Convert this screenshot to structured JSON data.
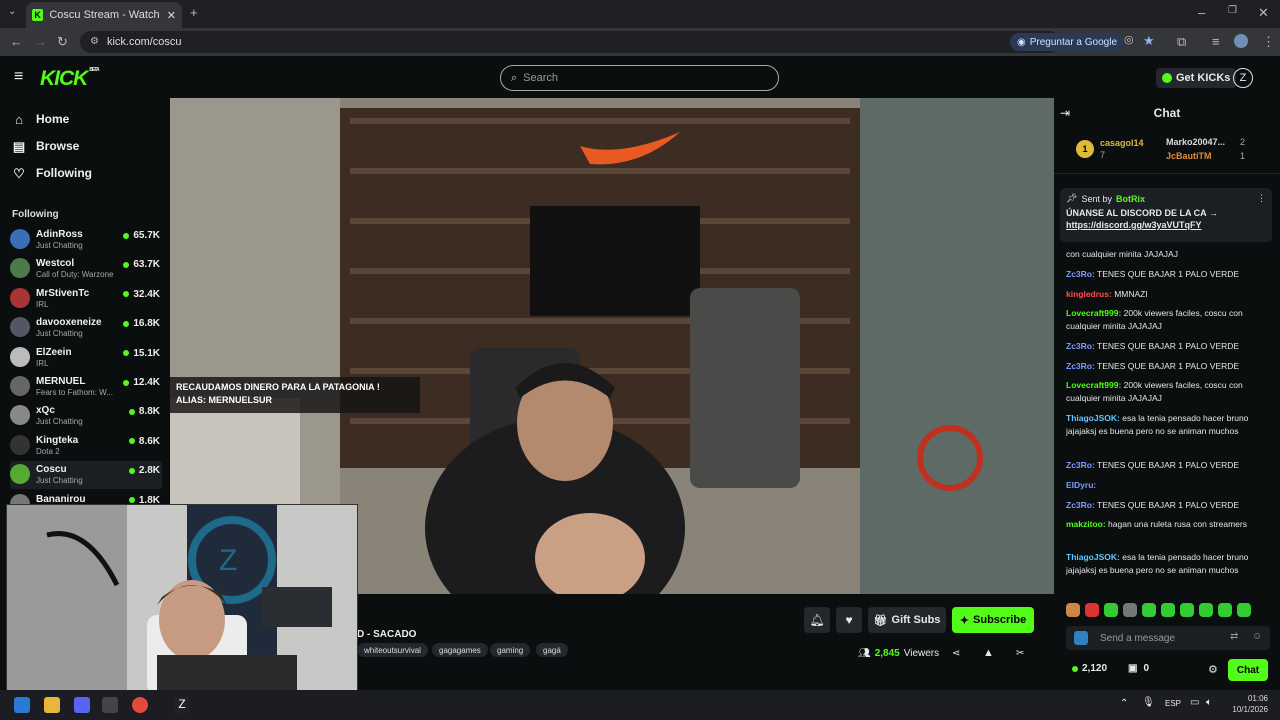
{
  "browser": {
    "tab_title": "Coscu Stream - Watch Live on K",
    "url": "kick.com/coscu",
    "ask_google": "Preguntar a Google"
  },
  "site": {
    "logo": "KICK",
    "logo_badge": "BETA",
    "search_placeholder": "Search",
    "get_kicks": "Get KICKs"
  },
  "sidebar": {
    "nav": [
      {
        "label": "Home",
        "icon": "home-icon"
      },
      {
        "label": "Browse",
        "icon": "browse-icon"
      },
      {
        "label": "Following",
        "icon": "heart-icon"
      }
    ],
    "following_header": "Following",
    "channels": [
      {
        "name": "AdinRoss",
        "category": "Just Chatting",
        "viewers": "65.7K"
      },
      {
        "name": "Westcol",
        "category": "Call of Duty: Warzone",
        "viewers": "63.7K"
      },
      {
        "name": "MrStivenTc",
        "category": "IRL",
        "viewers": "32.4K"
      },
      {
        "name": "davooxeneize",
        "category": "Just Chatting",
        "viewers": "16.8K"
      },
      {
        "name": "ElZeein",
        "category": "IRL",
        "viewers": "15.1K"
      },
      {
        "name": "MERNUEL",
        "category": "Fears to Fathom: W...",
        "viewers": "12.4K"
      },
      {
        "name": "xQc",
        "category": "Just Chatting",
        "viewers": "8.8K"
      },
      {
        "name": "Kingteka",
        "category": "Dota 2",
        "viewers": "8.6K"
      },
      {
        "name": "Coscu",
        "category": "Just Chatting",
        "viewers": "2.8K"
      },
      {
        "name": "Bananirou",
        "category": "",
        "viewers": "1.8K"
      }
    ]
  },
  "video": {
    "overlay_line1": "RECAUDAMOS DINERO PARA LA PATAGONIA !",
    "overlay_line2": "ALIAS: MERNUELSUR"
  },
  "stream": {
    "title": "D - SACADO",
    "tags": [
      "whiteoutsurvival",
      "gagagames",
      "gaming",
      "gagá"
    ],
    "gift_subs": "Gift Subs",
    "subscribe": "Subscribe",
    "viewers": "2,845",
    "viewers_label": "Viewers"
  },
  "chat": {
    "header": "Chat",
    "leader1_rank": "1",
    "leader1_name": "casagol14",
    "leader1_count": "7",
    "leader2_name": "Marko20047...",
    "leader2_count": "2",
    "leader3_name": "JcBautiTM",
    "leader3_count": "1",
    "pinned_sender_label": "Sent by",
    "pinned_sender": "BotRix",
    "pinned_text": "ÚNANSE AL DISCORD DE LA CA →",
    "pinned_link": "https://discord.gg/w3yaVUTqFY",
    "messages": [
      {
        "user": "",
        "text": "con cualquier minita JAJAJAJ",
        "color": "#e6e6e6"
      },
      {
        "user": "Zc3Ro:",
        "text": "TENES QUE BAJAR 1 PALO VERDE",
        "color": "#7d9bff"
      },
      {
        "user": "kingledrus:",
        "text": "MMNAZI",
        "color": "#ff4d4d"
      },
      {
        "user": "Lovecraft999:",
        "text": "200k viewers faciles, coscu con cualquier minita JAJAJAJ",
        "color": "#53fc18"
      },
      {
        "user": "Zc3Ro:",
        "text": "TENES QUE BAJAR 1 PALO VERDE",
        "color": "#7d9bff"
      },
      {
        "user": "Zc3Ro:",
        "text": "TENES QUE BAJAR 1 PALO VERDE",
        "color": "#7d9bff"
      },
      {
        "user": "Lovecraft999:",
        "text": "200k viewers faciles, coscu con cualquier minita JAJAJAJ",
        "color": "#53fc18"
      },
      {
        "user": "ThiagoJSOK:",
        "text": "esa la tenia pensado hacer bruno jajajaksj es buena pero no se animan muchos",
        "color": "#5ec8ff"
      },
      {
        "user": "Zc3Ro:",
        "text": "TENES QUE BAJAR 1 PALO VERDE",
        "color": "#7d9bff"
      },
      {
        "user": "ElDyru:",
        "text": "",
        "color": "#7d9bff"
      },
      {
        "user": "Zc3Ro:",
        "text": "TENES QUE BAJAR 1 PALO VERDE",
        "color": "#7d9bff"
      },
      {
        "user": "makzitoo:",
        "text": "hagan una ruleta rusa con streamers",
        "color": "#53fc18"
      },
      {
        "user": "ThiagoJSOK:",
        "text": "esa la tenia pensado hacer bruno jajajaksj es buena pero no se animan muchos",
        "color": "#5ec8ff"
      }
    ],
    "send_placeholder": "Send a message",
    "kicks_balance": "2,120",
    "other_balance": "0",
    "chat_button": "Chat"
  },
  "taskbar": {
    "lang": "ESP",
    "time": "01:06",
    "date": "10/1/2026"
  },
  "colors": {
    "accent": "#53fc18",
    "bg": "#0b0e0f"
  }
}
